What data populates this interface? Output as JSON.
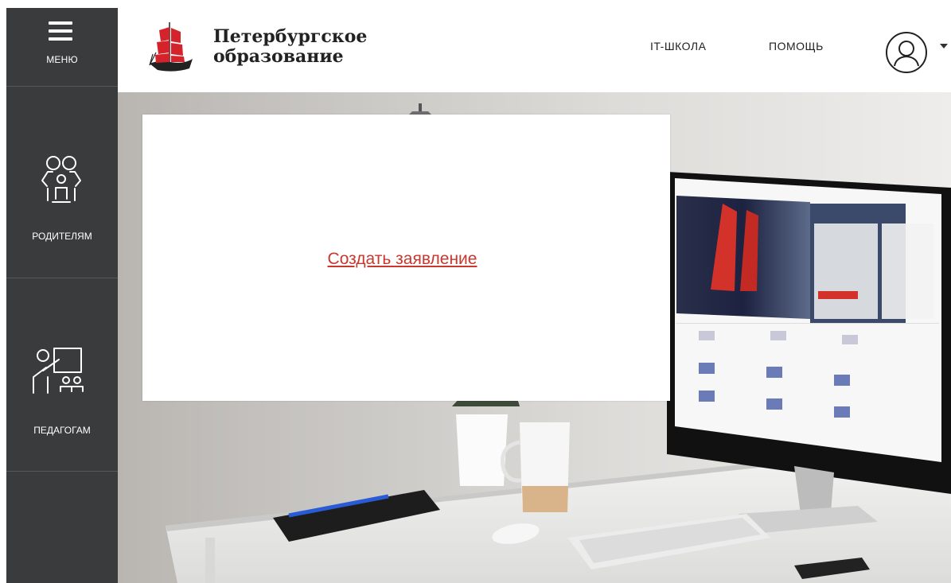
{
  "sidebar": {
    "menu_label": "МЕНЮ",
    "items": [
      {
        "label": "РОДИТЕЛЯМ",
        "icon": "parents-icon"
      },
      {
        "label": "ПЕДАГОГАМ",
        "icon": "teacher-icon"
      }
    ]
  },
  "header": {
    "logo_line1": "Петербургское",
    "logo_line2": "образование",
    "nav": [
      {
        "label": "IT-ШКОЛА"
      },
      {
        "label": "ПОМОЩЬ"
      }
    ],
    "user_icon": "user-avatar-icon"
  },
  "modal": {
    "link_text": "Создать заявление"
  },
  "colors": {
    "sidebar_bg": "#3a3b3d",
    "link_red": "#c8382f",
    "logo_red": "#d4232b"
  }
}
